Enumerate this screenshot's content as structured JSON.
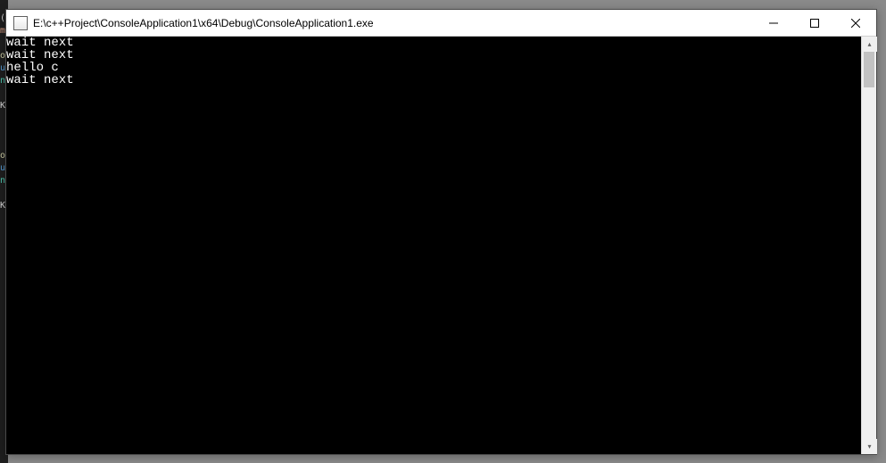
{
  "window": {
    "title": "E:\\c++Project\\ConsoleApplication1\\x64\\Debug\\ConsoleApplication1.exe"
  },
  "output_lines": [
    "wait next",
    "wait next",
    "hello c",
    "wait next"
  ],
  "ide_fragments": [
    "(",
    "me",
    "",
    "or",
    "us",
    "nd",
    "",
    "K+",
    "",
    "",
    "",
    "or",
    "us",
    "nd",
    "",
    "K+"
  ],
  "scrollbar": {
    "up": "▴",
    "down": "▾"
  }
}
